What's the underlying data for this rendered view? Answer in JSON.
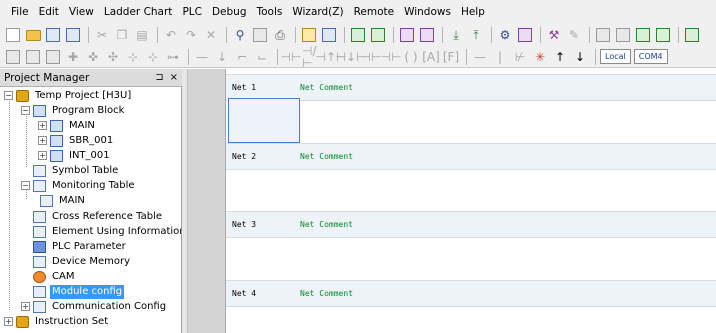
{
  "menu": [
    "File",
    "Edit",
    "View",
    "Ladder Chart",
    "PLC",
    "Debug",
    "Tools",
    "Wizard(Z)",
    "Remote",
    "Windows",
    "Help"
  ],
  "toolbar1_icons": [
    "new-file-icon",
    "open-folder-icon",
    "save-icon",
    "save-all-icon",
    "cut-icon",
    "copy-icon",
    "paste-icon",
    "undo-icon",
    "redo-icon",
    "delete-icon",
    "find-icon",
    "print-preview-icon",
    "print-icon",
    "compile-icon",
    "convert-icon",
    "monitor-icon",
    "monitor-edit-icon",
    "run-icon",
    "stop-icon",
    "download-icon",
    "upload-icon",
    "diagnose-icon",
    "compare-icon",
    "pen-icon",
    "tool-icon",
    "window-a-icon",
    "window-b-icon",
    "window-c-icon",
    "window-d-icon"
  ],
  "toolbar2": {
    "local_label": "Local",
    "com_label": "COM4"
  },
  "project_manager": {
    "title": "Project Manager",
    "pin": "⊐",
    "close": "×",
    "tree": [
      {
        "label": "Temp Project [H3U]",
        "icon": "project-icon"
      },
      {
        "label": "Program Block",
        "icon": "program-block-icon"
      },
      {
        "label": "MAIN",
        "icon": "program-icon"
      },
      {
        "label": "SBR_001",
        "icon": "program-icon"
      },
      {
        "label": "INT_001",
        "icon": "program-icon"
      },
      {
        "label": "Symbol Table",
        "icon": "symbol-table-icon"
      },
      {
        "label": "Monitoring Table",
        "icon": "monitoring-table-icon"
      },
      {
        "label": "MAIN",
        "icon": "table-icon"
      },
      {
        "label": "Cross Reference Table",
        "icon": "cross-reference-icon"
      },
      {
        "label": "Element Using Information T",
        "icon": "element-info-icon"
      },
      {
        "label": "PLC Parameter",
        "icon": "plc-parameter-icon"
      },
      {
        "label": "Device Memory",
        "icon": "device-memory-icon"
      },
      {
        "label": "CAM",
        "icon": "cam-icon"
      },
      {
        "label": "Module config",
        "icon": "module-config-icon",
        "selected": true
      },
      {
        "label": "Communication Config",
        "icon": "communication-config-icon"
      },
      {
        "label": "Instruction Set",
        "icon": "instruction-set-icon"
      }
    ]
  },
  "networks": [
    {
      "label": "Net 1",
      "comment": "Net Comment"
    },
    {
      "label": "Net 2",
      "comment": "Net Comment"
    },
    {
      "label": "Net 3",
      "comment": "Net Comment"
    },
    {
      "label": "Net 4",
      "comment": "Net Comment"
    }
  ],
  "colors": {
    "selection": "#3399ff",
    "comment_text": "#0a8a2a",
    "net_header_bg": "#eef3f7"
  }
}
